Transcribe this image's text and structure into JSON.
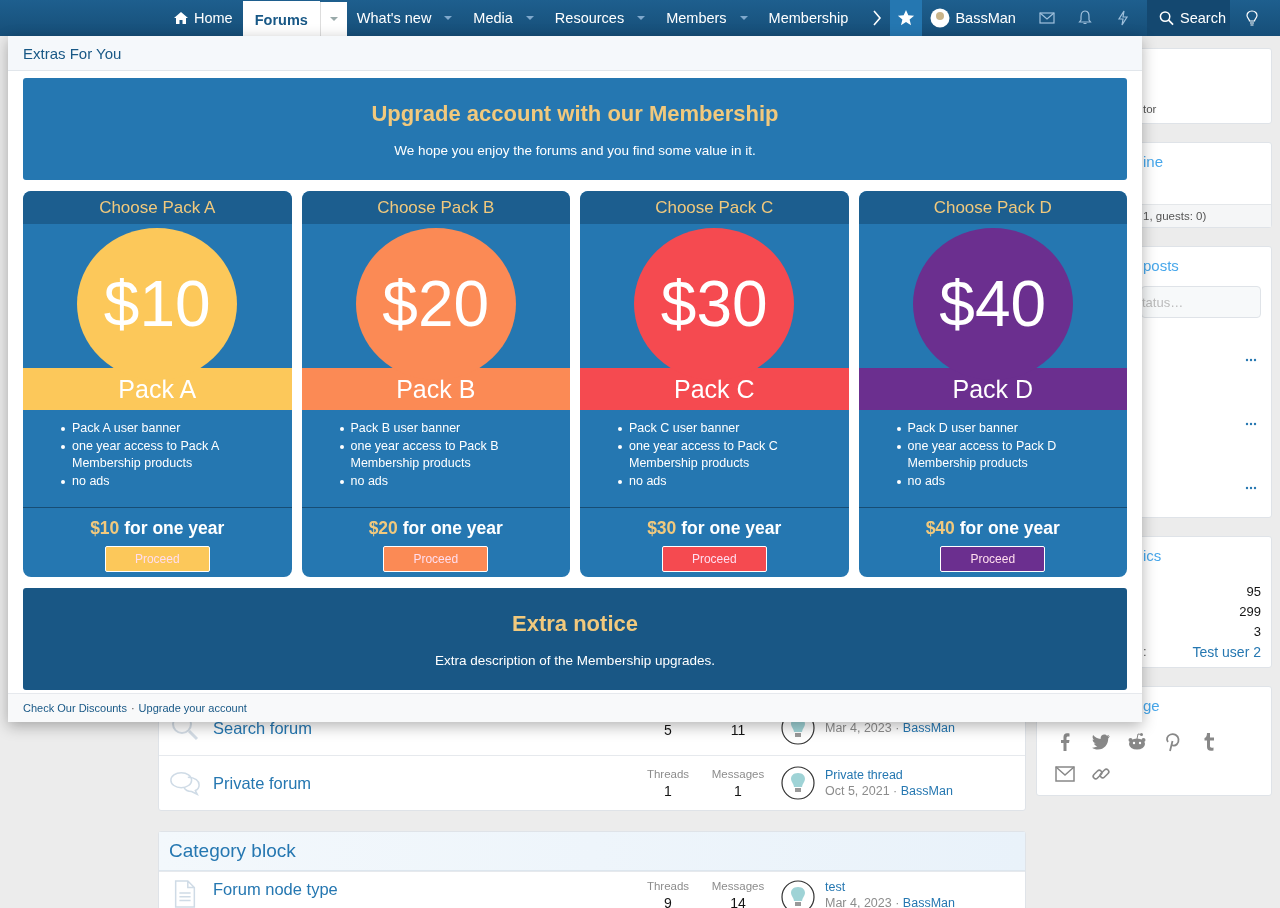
{
  "nav": {
    "items": [
      {
        "label": "Home",
        "kind": "home",
        "selected": false,
        "dropdown": false
      },
      {
        "label": "Forums",
        "selected": true,
        "dropdown": true
      },
      {
        "label": "What's new",
        "selected": false,
        "dropdown": true
      },
      {
        "label": "Media",
        "selected": false,
        "dropdown": true
      },
      {
        "label": "Resources",
        "selected": false,
        "dropdown": true
      },
      {
        "label": "Members",
        "selected": false,
        "dropdown": true
      },
      {
        "label": "Membership",
        "selected": false,
        "dropdown": false
      }
    ],
    "user": "BassMan",
    "search": "Search"
  },
  "popup": {
    "title": "Extras For You",
    "banner": {
      "title": "Upgrade account with our Membership",
      "text": "We hope you enjoy the forums and you find some value in it."
    },
    "packs": [
      {
        "header": "Choose Pack A",
        "big_price": "$10",
        "name": "Pack A",
        "features": [
          "Pack A user banner",
          "one year access to Pack A Membership products",
          "no ads"
        ],
        "price": "$10",
        "price_suffix": "for one year",
        "button": "Proceed",
        "color": "#fcc85a"
      },
      {
        "header": "Choose Pack B",
        "big_price": "$20",
        "name": "Pack B",
        "features": [
          "Pack B user banner",
          "one year access to Pack B Membership products",
          "no ads"
        ],
        "price": "$20",
        "price_suffix": "for one year",
        "button": "Proceed",
        "color": "#fb8a55"
      },
      {
        "header": "Choose Pack C",
        "big_price": "$30",
        "name": "Pack C",
        "features": [
          "Pack C user banner",
          "one year access to Pack C Membership products",
          "no ads"
        ],
        "price": "$30",
        "price_suffix": "for one year",
        "button": "Proceed",
        "color": "#f54a50"
      },
      {
        "header": "Choose Pack D",
        "big_price": "$40",
        "name": "Pack D",
        "features": [
          "Pack D user banner",
          "one year access to Pack D Membership products",
          "no ads"
        ],
        "price": "$40",
        "price_suffix": "for one year",
        "button": "Proceed",
        "color": "#6b2f8f"
      }
    ],
    "notice": {
      "title": "Extra notice",
      "text": "Extra description of the Membership upgrades."
    },
    "footer_links": [
      "Check Our Discounts",
      "Upgrade your account"
    ],
    "footer_separator": "·"
  },
  "forums": [
    {
      "title": "Search forum",
      "kind": "search",
      "threads": "5",
      "messages": "11",
      "date": "Mar 4, 2023",
      "separator": "·",
      "user": "BassMan"
    },
    {
      "title": "Private forum",
      "kind": "chat",
      "threads_label": "Threads",
      "messages_label": "Messages",
      "threads": "1",
      "messages": "1",
      "last_title": "Private thread",
      "date": "Oct 5, 2021",
      "separator": "·",
      "user": "BassMan"
    }
  ],
  "category": {
    "title": "Category block",
    "forums": [
      {
        "title": "Forum node type",
        "kind": "doc",
        "threads_label": "Threads",
        "messages_label": "Messages",
        "threads": "9",
        "messages": "14",
        "last_title": "test",
        "date": "Mar 4, 2023",
        "separator": "·",
        "user": "BassMan"
      }
    ]
  },
  "sidebar": {
    "staff": {
      "fragment": "tor"
    },
    "online": {
      "title": "ine",
      "footer": "1, guests: 0)"
    },
    "posts": {
      "title": "posts",
      "placeholder": "tatus…"
    },
    "statistics": {
      "title": "ics",
      "rows": [
        {
          "value": "95",
          "link": false
        },
        {
          "value": "299",
          "link": false
        },
        {
          "value": "3",
          "link": false
        },
        {
          "label": ":",
          "value": "Test user 2",
          "link": true
        }
      ]
    },
    "share": {
      "title": "ge"
    }
  }
}
